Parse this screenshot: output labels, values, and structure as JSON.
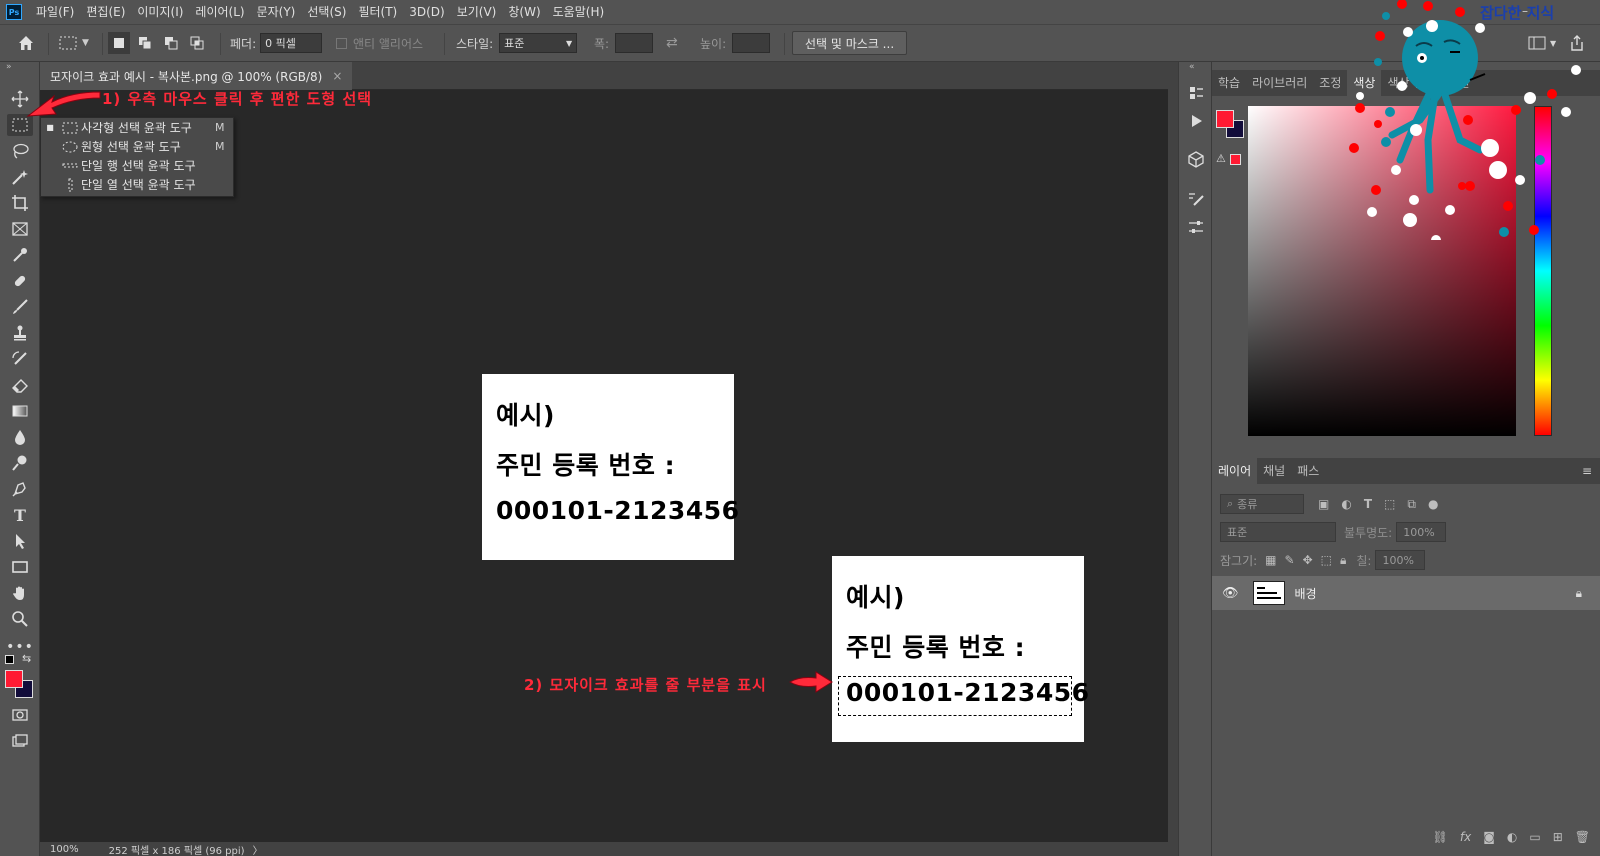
{
  "app": {
    "logo_text": "Ps",
    "menu": [
      "파일(F)",
      "편집(E)",
      "이미지(I)",
      "레이어(L)",
      "문자(Y)",
      "선택(S)",
      "필터(T)",
      "3D(D)",
      "보기(V)",
      "창(W)",
      "도움말(H)"
    ],
    "window_min": "–",
    "watermark": "잡다한 지식"
  },
  "options": {
    "feather_label": "페더:",
    "feather_value": "0 픽셀",
    "antialias_label": "앤티 앨리어스",
    "style_label": "스타일:",
    "style_value": "표준",
    "width_label": "폭:",
    "height_label": "높이:",
    "select_mask_button": "선택 및 마스크 ..."
  },
  "document": {
    "tab_title": "모자이크 효과 예시 - 복사본.png @ 100% (RGB/8)",
    "tab_close": "×",
    "zoom": "100%",
    "size_info": "252 픽셀 x 186 픽셀 (96 ppi)",
    "status_arrow": "〉",
    "image1": {
      "line1": "예시)",
      "line2": "주민 등록 번호 :",
      "line3": "000101-2123456"
    },
    "image2": {
      "line1": "예시)",
      "line2": "주민 등록 번호 :",
      "line3": "000101-2123456"
    }
  },
  "annotations": {
    "step1": "1) 우측 마우스 클릭 후 편한 도형 선택",
    "step2": "2) 모자이크 효과를 줄 부분을 표시"
  },
  "tool_popup": {
    "items": [
      {
        "label": "사각형 선택 윤곽 도구",
        "key": "M",
        "icon": "rect-marquee-icon",
        "selected": true
      },
      {
        "label": "원형 선택 윤곽 도구",
        "key": "M",
        "icon": "ellipse-marquee-icon",
        "selected": false
      },
      {
        "label": "단일 행 선택 윤곽 도구",
        "key": "",
        "icon": "single-row-marquee-icon",
        "selected": false
      },
      {
        "label": "단일 열 선택 윤곽 도구",
        "key": "",
        "icon": "single-column-marquee-icon",
        "selected": false
      }
    ]
  },
  "panels": {
    "top_tabs": [
      "학습",
      "라이브러리",
      "조정",
      "색상",
      "색상 견본",
      "패턴"
    ],
    "top_active": "색상",
    "colors": {
      "foreground": "#ff1a33",
      "background": "#120c3a",
      "accent": "#31a8ff"
    },
    "layers_tabs": [
      "레이어",
      "채널",
      "패스"
    ],
    "filter_kind": "종류",
    "blend_mode": "표준",
    "opacity_label": "불투명도:",
    "opacity_value": "100%",
    "lock_label": "잠그기:",
    "fill_label": "칠:",
    "fill_value": "100%",
    "layer_name": "배경",
    "footer_icons": [
      "link-icon",
      "fx-icon",
      "mask-icon",
      "adjustment-icon",
      "group-icon",
      "new-layer-icon",
      "trash-icon"
    ],
    "fx_label": "fx"
  }
}
